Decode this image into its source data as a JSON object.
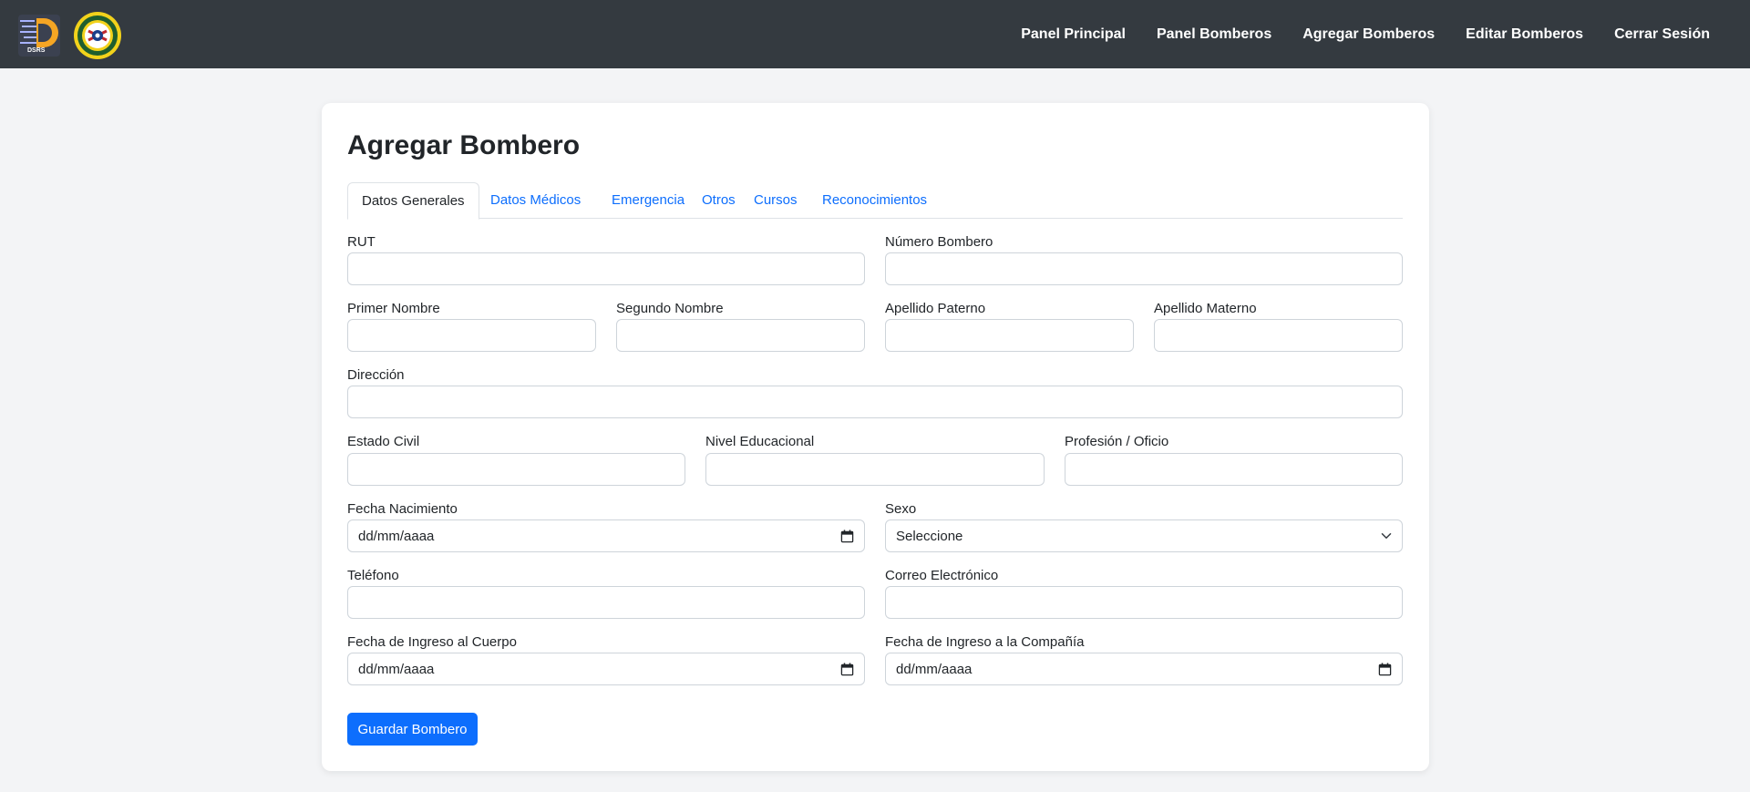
{
  "logos": {
    "dsrs_text": "DSRS"
  },
  "nav": [
    {
      "label": "Panel Principal"
    },
    {
      "label": "Panel Bomberos"
    },
    {
      "label": "Agregar Bomberos"
    },
    {
      "label": "Editar Bomberos"
    },
    {
      "label": "Cerrar Sesión"
    }
  ],
  "page": {
    "title": "Agregar Bombero"
  },
  "tabs": [
    {
      "label": "Datos Generales",
      "active": true
    },
    {
      "label": "Datos Médicos",
      "active": false
    },
    {
      "label": "Emergencia",
      "active": false
    },
    {
      "label": "Otros",
      "active": false
    },
    {
      "label": "Cursos",
      "active": false
    },
    {
      "label": "Reconocimientos",
      "active": false
    }
  ],
  "form": {
    "rut": {
      "label": "RUT",
      "value": ""
    },
    "numero_bombero": {
      "label": "Número Bombero",
      "value": ""
    },
    "primer_nombre": {
      "label": "Primer Nombre",
      "value": ""
    },
    "segundo_nombre": {
      "label": "Segundo Nombre",
      "value": ""
    },
    "apellido_paterno": {
      "label": "Apellido Paterno",
      "value": ""
    },
    "apellido_materno": {
      "label": "Apellido Materno",
      "value": ""
    },
    "direccion": {
      "label": "Dirección",
      "value": ""
    },
    "estado_civil": {
      "label": "Estado Civil",
      "value": ""
    },
    "nivel_educacional": {
      "label": "Nivel Educacional",
      "value": ""
    },
    "profesion": {
      "label": "Profesión / Oficio",
      "value": ""
    },
    "fecha_nacimiento": {
      "label": "Fecha Nacimiento",
      "value": "dd/mm/aaaa"
    },
    "sexo": {
      "label": "Sexo",
      "value": "Seleccione"
    },
    "telefono": {
      "label": "Teléfono",
      "value": ""
    },
    "correo": {
      "label": "Correo Electrónico",
      "value": ""
    },
    "fecha_ingreso_cuerpo": {
      "label": "Fecha de Ingreso al Cuerpo",
      "value": "dd/mm/aaaa"
    },
    "fecha_ingreso_compania": {
      "label": "Fecha de Ingreso a la Compañía",
      "value": "dd/mm/aaaa"
    }
  },
  "actions": {
    "save_label": "Guardar Bombero"
  },
  "colors": {
    "navbar": "#343a40",
    "primary": "#0d6efd",
    "background": "#f3f4f6"
  }
}
